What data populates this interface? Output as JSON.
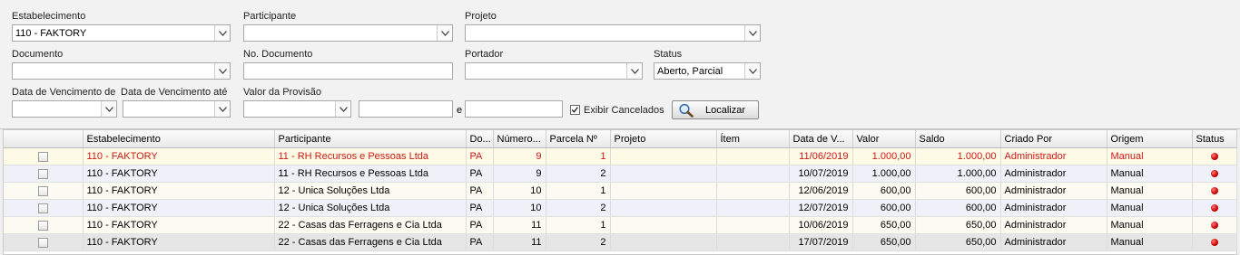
{
  "filters": {
    "estabelecimento": {
      "label": "Estabelecimento",
      "value": "110 - FAKTORY"
    },
    "participante": {
      "label": "Participante",
      "value": ""
    },
    "projeto": {
      "label": "Projeto",
      "value": ""
    },
    "documento": {
      "label": "Documento",
      "value": ""
    },
    "no_documento": {
      "label": "No. Documento",
      "value": ""
    },
    "portador": {
      "label": "Portador",
      "value": ""
    },
    "status": {
      "label": "Status",
      "value": "Aberto, Parcial"
    },
    "venc_de": {
      "label": "Data de Vencimento de",
      "value": ""
    },
    "venc_ate": {
      "label": "Data de Vencimento até",
      "value": ""
    },
    "valor_provisao": {
      "label": "Valor da Provisão",
      "value": "",
      "from": "",
      "to": ""
    },
    "and_label": "e",
    "exibir_cancelados": {
      "label": "Exibir Cancelados",
      "checked": true
    },
    "localizar_label": "Localizar"
  },
  "table": {
    "columns": [
      "",
      "Estabelecimento",
      "Participante",
      "Do...",
      "Número...",
      "Parcela Nº",
      "Projeto",
      "Ítem",
      "Data de V...",
      "Valor",
      "Saldo",
      "Criado Por",
      "Origem",
      "Status"
    ],
    "rows": [
      {
        "estab": "110 - FAKTORY",
        "part": "11 - RH Recursos e Pessoas Ltda",
        "doc": "PA",
        "num": "9",
        "parc": "1",
        "proj": "",
        "item": "",
        "data": "11/06/2019",
        "valor": "1.000,00",
        "saldo": "1.000,00",
        "criado": "Administrador",
        "origem": "Manual"
      },
      {
        "estab": "110 - FAKTORY",
        "part": "11 - RH Recursos e Pessoas Ltda",
        "doc": "PA",
        "num": "9",
        "parc": "2",
        "proj": "",
        "item": "",
        "data": "10/07/2019",
        "valor": "1.000,00",
        "saldo": "1.000,00",
        "criado": "Administrador",
        "origem": "Manual"
      },
      {
        "estab": "110 - FAKTORY",
        "part": "12 - Unica Soluções Ltda",
        "doc": "PA",
        "num": "10",
        "parc": "1",
        "proj": "",
        "item": "",
        "data": "12/06/2019",
        "valor": "600,00",
        "saldo": "600,00",
        "criado": "Administrador",
        "origem": "Manual"
      },
      {
        "estab": "110 - FAKTORY",
        "part": "12 - Unica Soluções Ltda",
        "doc": "PA",
        "num": "10",
        "parc": "2",
        "proj": "",
        "item": "",
        "data": "12/07/2019",
        "valor": "600,00",
        "saldo": "600,00",
        "criado": "Administrador",
        "origem": "Manual"
      },
      {
        "estab": "110 - FAKTORY",
        "part": "22 - Casas das Ferragens e Cia Ltda",
        "doc": "PA",
        "num": "11",
        "parc": "1",
        "proj": "",
        "item": "",
        "data": "10/06/2019",
        "valor": "650,00",
        "saldo": "650,00",
        "criado": "Administrador",
        "origem": "Manual"
      },
      {
        "estab": "110 - FAKTORY",
        "part": "22 - Casas das Ferragens e Cia Ltda",
        "doc": "PA",
        "num": "11",
        "parc": "2",
        "proj": "",
        "item": "",
        "data": "17/07/2019",
        "valor": "650,00",
        "saldo": "650,00",
        "criado": "Administrador",
        "origem": "Manual"
      }
    ]
  },
  "colors": {
    "selected_row_text": "#d01818",
    "status_dot": "#c80000"
  }
}
